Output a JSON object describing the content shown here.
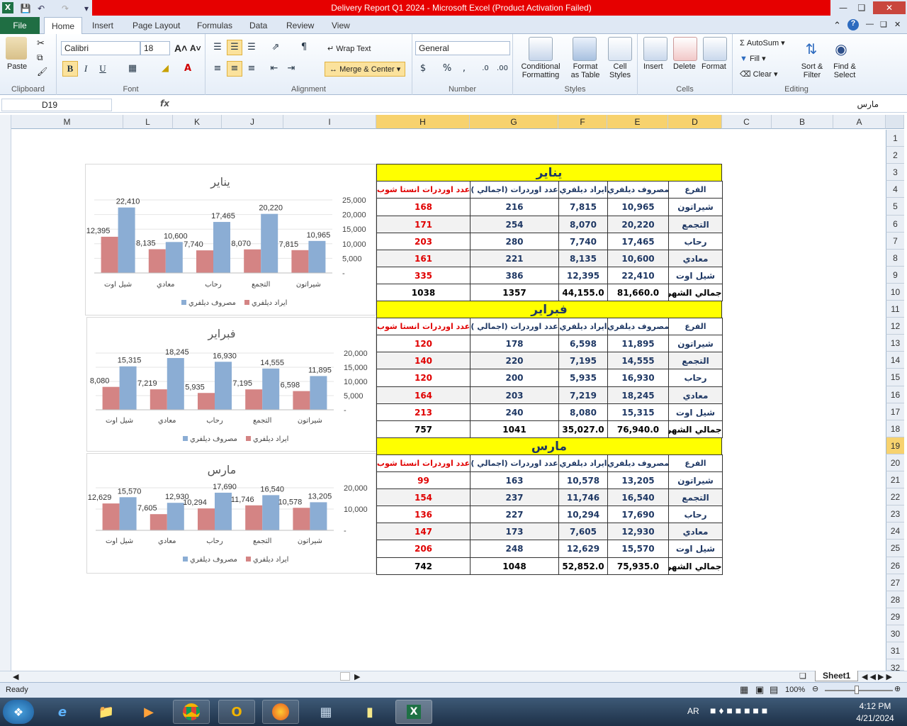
{
  "window": {
    "title": "Delivery Report Q1 2024  -  Microsoft Excel (Product Activation Failed)"
  },
  "tabs": [
    "File",
    "Home",
    "Insert",
    "Page Layout",
    "Formulas",
    "Data",
    "Review",
    "View"
  ],
  "ribbon": {
    "clipboard": {
      "paste": "Paste",
      "label": "Clipboard"
    },
    "font": {
      "name": "Calibri",
      "size": "18",
      "label": "Font",
      "bold": "B",
      "italic": "I",
      "underline": "U"
    },
    "alignment": {
      "wrap": "Wrap Text",
      "merge": "Merge & Center",
      "label": "Alignment"
    },
    "number": {
      "format": "General",
      "label": "Number"
    },
    "styles": {
      "cond1": "Conditional",
      "cond2": "Formatting",
      "fat1": "Format",
      "fat2": "as Table",
      "cs1": "Cell",
      "cs2": "Styles",
      "label": "Styles"
    },
    "cells": {
      "insert": "Insert",
      "delete": "Delete",
      "format": "Format",
      "label": "Cells"
    },
    "editing": {
      "autosum": "AutoSum",
      "fill": "Fill",
      "clear": "Clear",
      "sort1": "Sort &",
      "sort2": "Filter",
      "find1": "Find &",
      "find2": "Select",
      "label": "Editing"
    }
  },
  "formula_bar": {
    "namebox": "D19",
    "fx": "fx",
    "content": "مارس"
  },
  "columns": [
    {
      "l": "M",
      "sel": false
    },
    {
      "l": "L",
      "sel": false
    },
    {
      "l": "K",
      "sel": false
    },
    {
      "l": "J",
      "sel": false
    },
    {
      "l": "I",
      "sel": false
    },
    {
      "l": "H",
      "sel": true
    },
    {
      "l": "G",
      "sel": true
    },
    {
      "l": "F",
      "sel": true
    },
    {
      "l": "E",
      "sel": true
    },
    {
      "l": "D",
      "sel": true
    },
    {
      "l": "C",
      "sel": false
    },
    {
      "l": "B",
      "sel": false
    },
    {
      "l": "A",
      "sel": false
    }
  ],
  "rows": [
    "1",
    "2",
    "3",
    "4",
    "5",
    "6",
    "7",
    "8",
    "9",
    "10",
    "11",
    "12",
    "13",
    "14",
    "15",
    "16",
    "17",
    "18",
    "19",
    "20",
    "21",
    "22",
    "23",
    "24",
    "25",
    "26",
    "27",
    "28",
    "29",
    "30",
    "31",
    "32"
  ],
  "selected_row": "19",
  "headers": [
    "الفرع",
    "مصروف ديلفري",
    "ايراد ديلفري",
    "عدد اوردرات (اجمالي )",
    "عدد اوردرات انستا شوب"
  ],
  "months": [
    {
      "name": "يناير",
      "rows": [
        [
          "شيراتون",
          "10,965",
          "7,815",
          "216",
          "168"
        ],
        [
          "التجمع",
          "20,220",
          "8,070",
          "254",
          "171"
        ],
        [
          "رحاب",
          "17,465",
          "7,740",
          "280",
          "203"
        ],
        [
          "معادي",
          "10,600",
          "8,135",
          "221",
          "161"
        ],
        [
          "شيل اوت",
          "22,410",
          "12,395",
          "386",
          "335"
        ]
      ],
      "total": [
        "اجمالي الشهر",
        "81,660.0",
        "44,155.0",
        "1357",
        "1038"
      ]
    },
    {
      "name": "فبراير",
      "rows": [
        [
          "شيراتون",
          "11,895",
          "6,598",
          "178",
          "120"
        ],
        [
          "التجمع",
          "14,555",
          "7,195",
          "220",
          "140"
        ],
        [
          "رحاب",
          "16,930",
          "5,935",
          "200",
          "120"
        ],
        [
          "معادي",
          "18,245",
          "7,219",
          "203",
          "164"
        ],
        [
          "شيل اوت",
          "15,315",
          "8,080",
          "240",
          "213"
        ]
      ],
      "total": [
        "اجمالي الشهر",
        "76,940.0",
        "35,027.0",
        "1041",
        "757"
      ]
    },
    {
      "name": "مارس",
      "rows": [
        [
          "شيراتون",
          "13,205",
          "10,578",
          "163",
          "99"
        ],
        [
          "التجمع",
          "16,540",
          "11,746",
          "237",
          "154"
        ],
        [
          "رحاب",
          "17,690",
          "10,294",
          "227",
          "136"
        ],
        [
          "معادي",
          "12,930",
          "7,605",
          "173",
          "147"
        ],
        [
          "شيل اوت",
          "15,570",
          "12,629",
          "248",
          "206"
        ]
      ],
      "total": [
        "اجمالي الشهر",
        "75,935.0",
        "52,852.0",
        "1048",
        "742"
      ]
    }
  ],
  "chart_data": [
    {
      "type": "bar",
      "title": "يناير",
      "categories": [
        "شيل اوت",
        "معادي",
        "رحاب",
        "التجمع",
        "شيراتون"
      ],
      "series": [
        {
          "name": "ايراد ديلفري",
          "values": [
            12395,
            8135,
            7740,
            8070,
            7815
          ]
        },
        {
          "name": "مصروف ديلفري",
          "values": [
            22410,
            10600,
            17465,
            20220,
            10965
          ]
        }
      ],
      "ylim": [
        0,
        25000
      ],
      "yticks": [
        "25,000",
        "20,000",
        "15,000",
        "10,000",
        "5,000",
        "-"
      ],
      "legend": "bottom"
    },
    {
      "type": "bar",
      "title": "فبراير",
      "categories": [
        "شيل اوت",
        "معادي",
        "رحاب",
        "التجمع",
        "شيراتون"
      ],
      "series": [
        {
          "name": "ايراد ديلفري",
          "values": [
            8080,
            7219,
            5935,
            7195,
            6598
          ]
        },
        {
          "name": "مصروف ديلفري",
          "values": [
            15315,
            18245,
            16930,
            14555,
            11895
          ]
        }
      ],
      "ylim": [
        0,
        20000
      ],
      "yticks": [
        "20,000",
        "15,000",
        "10,000",
        "5,000",
        "-"
      ],
      "legend": "bottom"
    },
    {
      "type": "bar",
      "title": "مارس",
      "categories": [
        "شيل اوت",
        "معادي",
        "رحاب",
        "التجمع",
        "شيراتون"
      ],
      "series": [
        {
          "name": "ايراد ديلفري",
          "values": [
            12629,
            7605,
            10294,
            11746,
            10578
          ]
        },
        {
          "name": "مصروف ديلفري",
          "values": [
            15570,
            12930,
            17690,
            16540,
            13205
          ]
        }
      ],
      "ylim": [
        0,
        20000
      ],
      "yticks": [
        "20,000",
        "10,000",
        "-"
      ],
      "legend": "bottom"
    }
  ],
  "colors": {
    "revenue": "#d48484",
    "expense": "#8badd4",
    "month_bg": "#ffff00",
    "title_bar": "#e60000"
  },
  "sheet": {
    "name": "Sheet1"
  },
  "status": {
    "ready": "Ready",
    "zoom": "100%"
  },
  "taskbar": {
    "lang": "AR",
    "time": "4:12 PM",
    "date": "4/21/2024"
  }
}
